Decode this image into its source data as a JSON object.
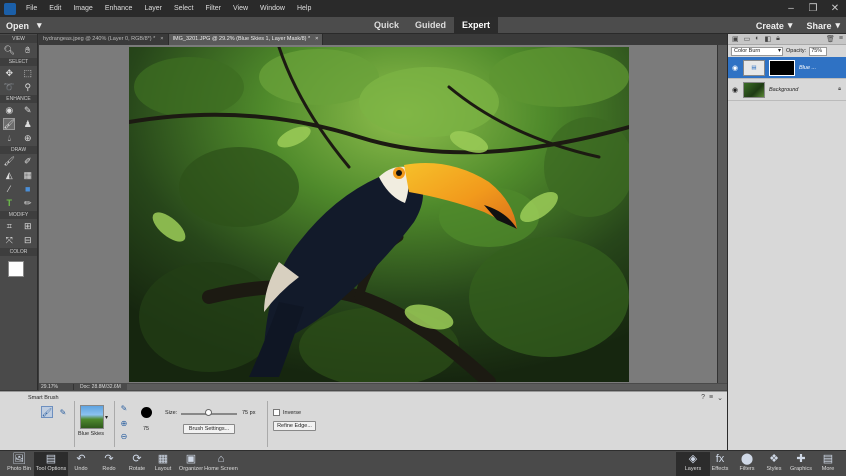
{
  "menubar": {
    "items": [
      "File",
      "Edit",
      "Image",
      "Enhance",
      "Layer",
      "Select",
      "Filter",
      "View",
      "Window",
      "Help"
    ]
  },
  "modebar": {
    "open_label": "Open",
    "modes": [
      "Quick",
      "Guided",
      "Expert"
    ],
    "active_mode": "Expert",
    "create_label": "Create",
    "share_label": "Share"
  },
  "toolbox": {
    "sections": [
      "VIEW",
      "SELECT",
      "ENHANCE",
      "DRAW",
      "MODIFY",
      "COLOR"
    ]
  },
  "doc_tabs": [
    {
      "label": "hydrangeas.jpeg @ 240% (Layer 0, RGB/8*) *",
      "close": "×"
    },
    {
      "label": "IMG_3201.JPG @ 29.2% (Blue Skies 1, Layer Mask/8) *",
      "close": "×"
    }
  ],
  "status": {
    "zoom": "29.17%",
    "docsize": "Doc: 28.8M/32.6M"
  },
  "layers": {
    "blend_mode": "Color Burn",
    "opacity_label": "Opacity:",
    "opacity_value": "75%",
    "items": [
      {
        "name": "Blue ...",
        "kind": "adjustment"
      },
      {
        "name": "Background",
        "kind": "photo"
      }
    ]
  },
  "tool_options": {
    "title": "Smart Brush",
    "preset_label": "Blue Skies",
    "brush_size_number": "75",
    "size_label": "Size:",
    "size_value": "75 px",
    "size_fraction": 0.45,
    "brush_settings_label": "Brush Settings...",
    "inverse_label": "Inverse",
    "refine_edge_label": "Refine Edge..."
  },
  "taskbar": {
    "left": [
      {
        "label": "Photo Bin",
        "icon": "photo-bin-icon"
      },
      {
        "label": "Tool Options",
        "icon": "tool-options-icon"
      },
      {
        "label": "Undo",
        "icon": "undo-icon"
      },
      {
        "label": "Redo",
        "icon": "redo-icon"
      },
      {
        "label": "Rotate",
        "icon": "rotate-icon"
      },
      {
        "label": "Layout",
        "icon": "layout-icon"
      },
      {
        "label": "Organizer",
        "icon": "organizer-icon"
      },
      {
        "label": "Home Screen",
        "icon": "home-screen-icon"
      }
    ],
    "right": [
      {
        "label": "Layers",
        "icon": "layers-icon"
      },
      {
        "label": "Effects",
        "icon": "effects-icon"
      },
      {
        "label": "Filters",
        "icon": "filters-icon"
      },
      {
        "label": "Styles",
        "icon": "styles-icon"
      },
      {
        "label": "Graphics",
        "icon": "graphics-icon"
      },
      {
        "label": "More",
        "icon": "more-icon"
      }
    ]
  },
  "colors": {
    "selection_blue": "#2f72c4",
    "toucan_beak": "#f29a1c"
  }
}
